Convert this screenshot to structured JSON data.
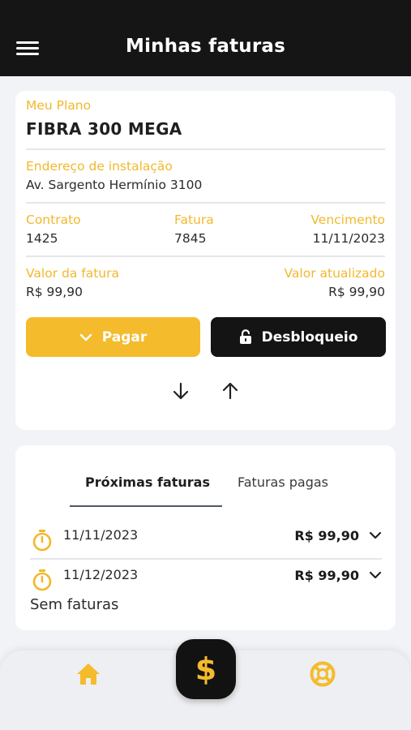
{
  "header": {
    "title": "Minhas faturas",
    "menu_icon": "hamburger-menu-icon"
  },
  "plan": {
    "label": "Meu Plano",
    "name": "FIBRA 300 MEGA",
    "address_label": "Endereço de instalação",
    "address": "Av. Sargento Hermínio 3100",
    "contract_label": "Contrato",
    "contract": "1425",
    "invoice_label": "Fatura",
    "invoice": "7845",
    "due_label": "Vencimento",
    "due": "11/11/2023",
    "amount_label": "Valor da fatura",
    "amount": "R$ 99,90",
    "updated_label": "Valor atualizado",
    "updated": "R$ 99,90"
  },
  "actions": {
    "pay_label": "Pagar",
    "pay_icon": "chevron-down-icon",
    "unlock_label": "Desbloqueio",
    "unlock_icon": "unlock-icon"
  },
  "invoices": {
    "tabs": [
      "Próximas faturas",
      "Faturas pagas"
    ],
    "active_tab": "Próximas faturas",
    "items": [
      {
        "date": "11/11/2023",
        "amount": "R$ 99,90"
      },
      {
        "date": "11/12/2023",
        "amount": "R$ 99,90"
      }
    ],
    "empty_text": "Sem faturas"
  },
  "bottom_nav": {
    "home_icon": "home-icon",
    "center_symbol": "$",
    "help_icon": "lifebuoy-icon"
  },
  "colors": {
    "accent": "#f4bb2c",
    "dark": "#151515",
    "background": "#f1f3f6",
    "card": "#ffffff"
  }
}
